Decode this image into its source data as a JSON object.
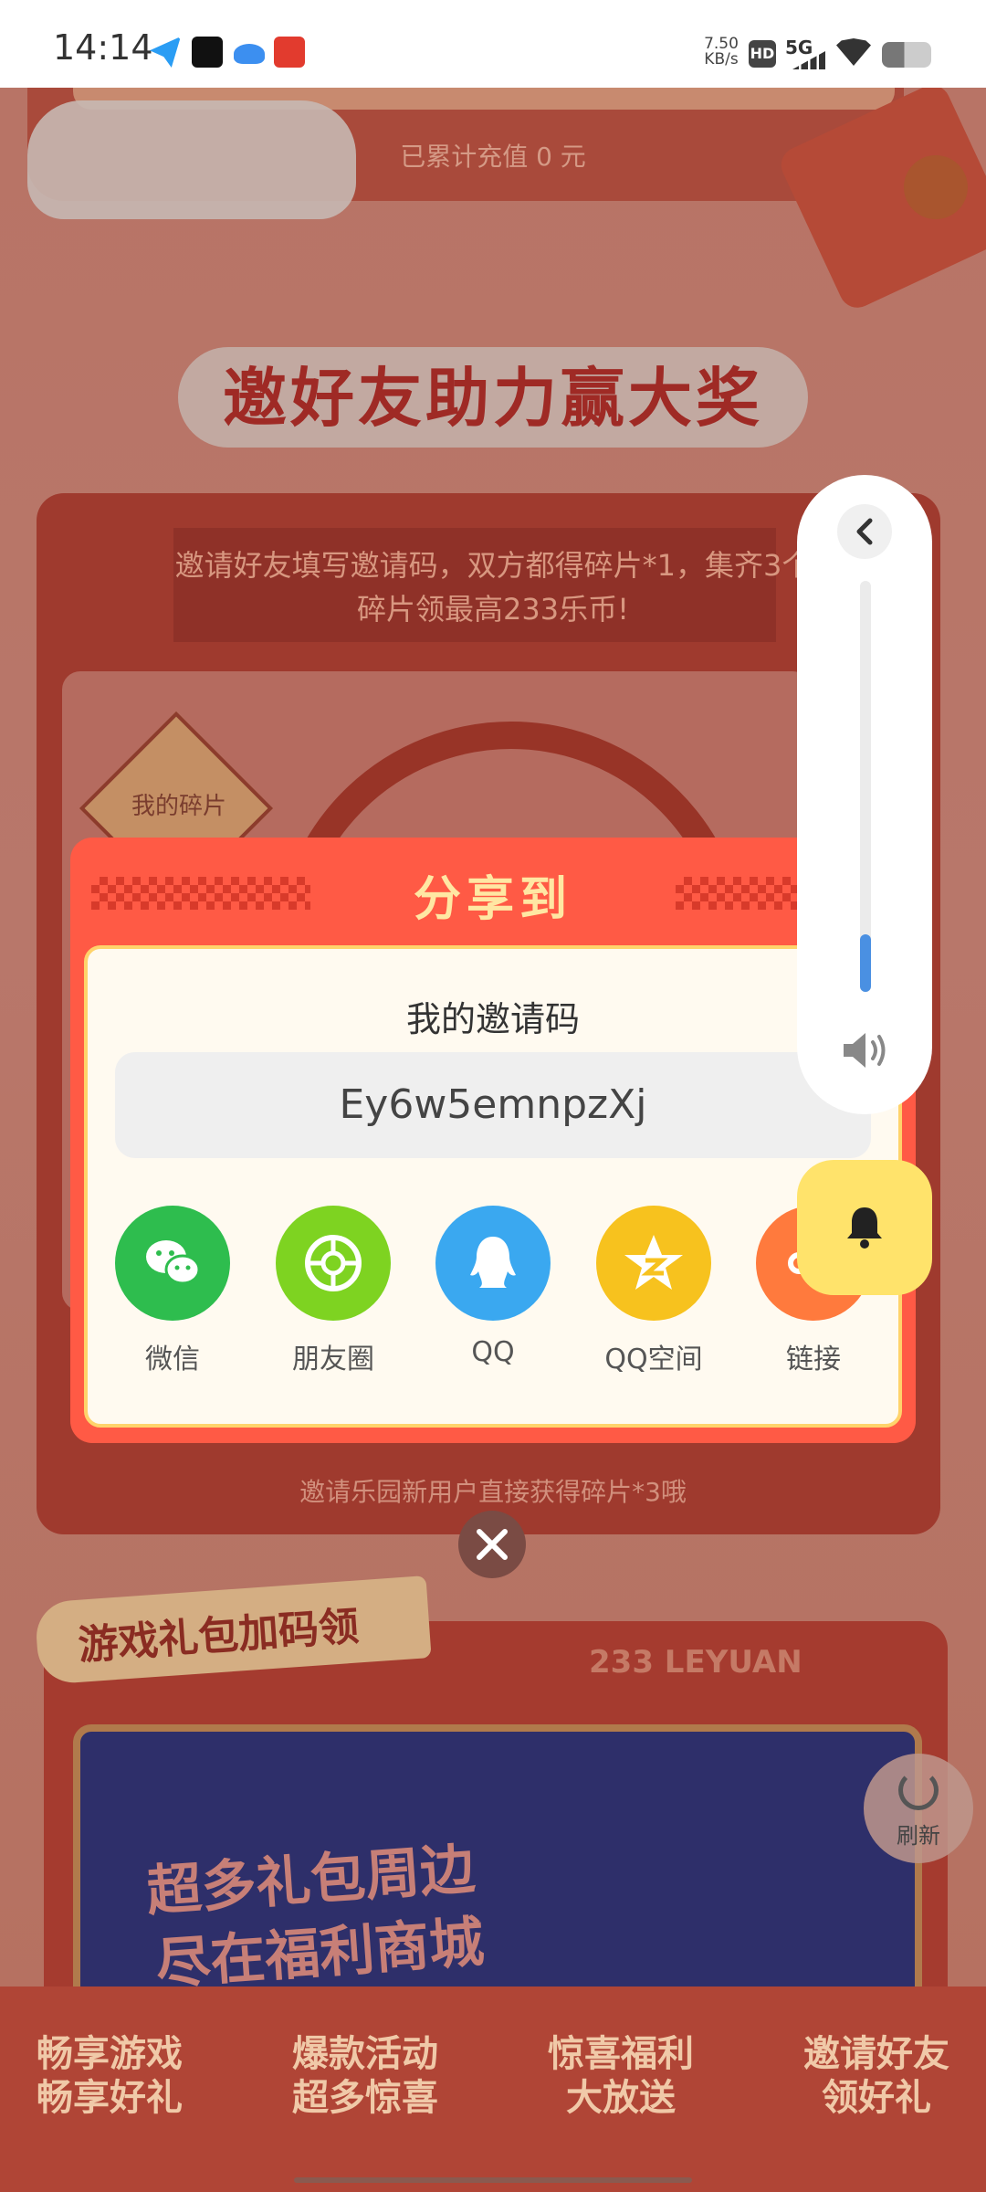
{
  "status_bar": {
    "time": "14:14",
    "network_speed": "7.50\nKB/s",
    "network_type": "5G",
    "hd_badge": "HD"
  },
  "background": {
    "recharge_text": "已累计充值 0 元",
    "invite_title": "邀好友助力赢大奖",
    "invite_description": "邀请好友填写邀请码，双方都得碎片*1，集齐3个碎片领最高233乐币!",
    "my_fragments_label": "我的碎片",
    "bottom_hint": "邀请乐园新用户直接获得碎片*3哦",
    "gift_section_title": "游戏礼包加码领",
    "leyuan_logo": "233 LEYUAN",
    "banner_line1": "超多礼包周边",
    "banner_line2": "尽在福利商城",
    "refresh_label": "刷新",
    "bottom_tabs": [
      {
        "line1": "畅享游戏",
        "line2": "畅享好礼"
      },
      {
        "line1": "爆款活动",
        "line2": "超多惊喜"
      },
      {
        "line1": "惊喜福利",
        "line2": "大放送"
      },
      {
        "line1": "邀请好友",
        "line2": "领好礼"
      }
    ]
  },
  "share_dialog": {
    "title": "分享到",
    "code_label": "我的邀请码",
    "invite_code": "Ey6w5emnpzXj",
    "targets": [
      {
        "label": "微信",
        "icon": "wechat-icon",
        "color": "#2ebd4e"
      },
      {
        "label": "朋友圈",
        "icon": "moments-icon",
        "color": "#7ed321"
      },
      {
        "label": "QQ",
        "icon": "qq-icon",
        "color": "#3aa8f0"
      },
      {
        "label": "QQ空间",
        "icon": "qzone-icon",
        "color": "#f7c21e"
      },
      {
        "label": "链接",
        "icon": "link-icon",
        "color": "#ff7a3d"
      }
    ]
  },
  "volume_panel": {
    "level_fraction": 0.14,
    "accent_color": "#4a90e2"
  }
}
